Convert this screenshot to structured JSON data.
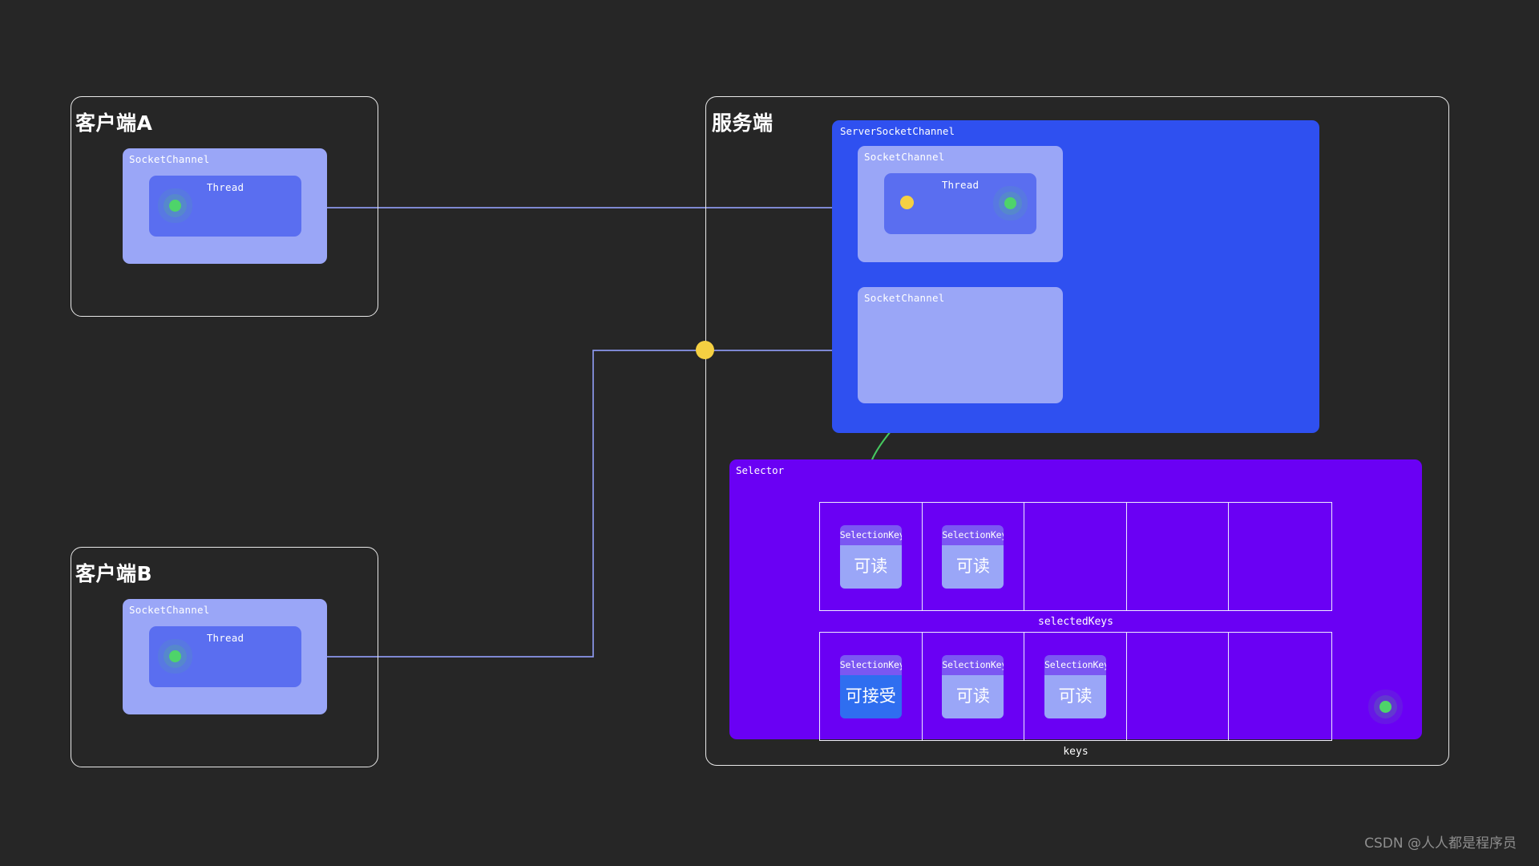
{
  "theme": {
    "background": "#262626",
    "panel_border": "#e8e8e8",
    "socket_channel": "#9aa6f7",
    "thread": "#5a6ef0",
    "server_socket_channel": "#2f50f0",
    "selector": "#6a00f4",
    "selection_key_head": "#7b57f2",
    "selection_key_body": "#9aa6f7",
    "accept_highlight": "#2f6ef0",
    "green_dot": "#4ed46a",
    "yellow_dot": "#f5d042",
    "wire": "#8b97ea",
    "arrow": "#46c85f",
    "watermark_text": "#8e8e8e"
  },
  "client_a": {
    "title": "客户端A",
    "socket_channel": {
      "label": "SocketChannel",
      "thread": {
        "label": "Thread",
        "green_dot": true
      }
    }
  },
  "client_b": {
    "title": "客户端B",
    "socket_channel": {
      "label": "SocketChannel",
      "thread": {
        "label": "Thread",
        "green_dot": true
      }
    }
  },
  "server": {
    "title": "服务端",
    "server_socket_channel": {
      "label": "ServerSocketChannel",
      "socket_channels": [
        {
          "label": "SocketChannel",
          "thread": {
            "label": "Thread",
            "yellow_dot": true,
            "green_dot": true
          }
        },
        {
          "label": "SocketChannel",
          "thread": null
        }
      ]
    },
    "selector": {
      "label": "Selector",
      "green_dot": true,
      "rows": [
        {
          "caption": "selectedKeys",
          "cells": [
            {
              "head": "SelectionKey",
              "state": "可读",
              "highlight": false
            },
            {
              "head": "SelectionKey",
              "state": "可读",
              "highlight": false
            },
            null,
            null,
            null
          ]
        },
        {
          "caption": "keys",
          "cells": [
            {
              "head": "SelectionKey",
              "state": "可接受",
              "highlight": true
            },
            {
              "head": "SelectionKey",
              "state": "可读",
              "highlight": false
            },
            {
              "head": "SelectionKey",
              "state": "可读",
              "highlight": false
            },
            null,
            null
          ]
        }
      ]
    }
  },
  "watermark": "CSDN @人人都是程序员"
}
